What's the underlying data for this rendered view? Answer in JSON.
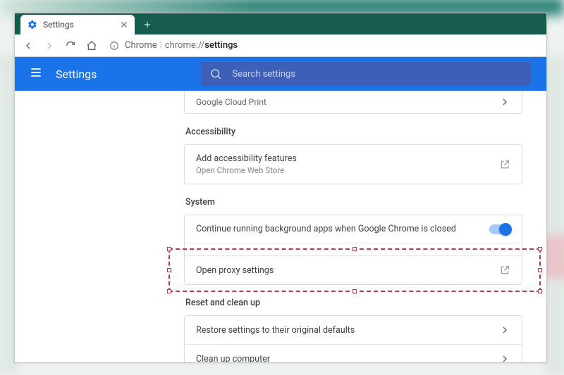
{
  "tab": {
    "title": "Settings"
  },
  "omnibox": {
    "chrome_label": "Chrome",
    "path_prefix": "chrome://",
    "path_page": "settings"
  },
  "header": {
    "title": "Settings",
    "search_placeholder": "Search settings"
  },
  "sections": {
    "cloud_print": {
      "label": "Google Cloud Print"
    },
    "accessibility": {
      "heading": "Accessibility",
      "add_title": "Add accessibility features",
      "add_sub": "Open Chrome Web Store"
    },
    "system": {
      "heading": "System",
      "bg_apps": "Continue running background apps when Google Chrome is closed",
      "proxy": "Open proxy settings"
    },
    "reset": {
      "heading": "Reset and clean up",
      "restore": "Restore settings to their original defaults",
      "cleanup": "Clean up computer"
    }
  }
}
